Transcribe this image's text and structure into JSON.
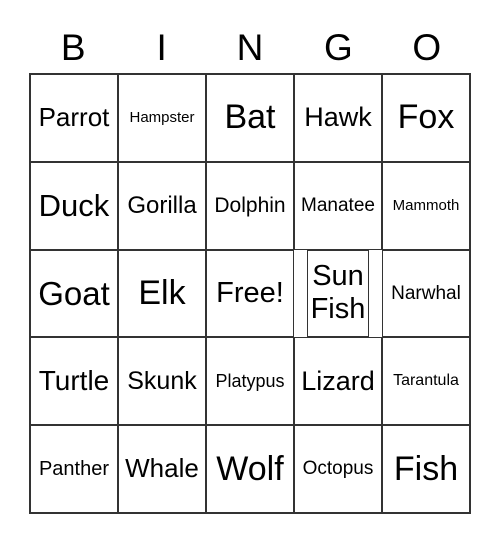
{
  "header": [
    "B",
    "I",
    "N",
    "G",
    "O"
  ],
  "cells": [
    [
      "Parrot",
      "Hampster",
      "Bat",
      "Hawk",
      "Fox"
    ],
    [
      "Duck",
      "Gorilla",
      "Dolphin",
      "Manatee",
      "Mammoth"
    ],
    [
      "Goat",
      "Elk",
      "Free!",
      "Sun Fish",
      "Narwhal"
    ],
    [
      "Turtle",
      "Skunk",
      "Platypus",
      "Lizard",
      "Tarantula"
    ],
    [
      "Panther",
      "Whale",
      "Wolf",
      "Octopus",
      "Fish"
    ]
  ]
}
